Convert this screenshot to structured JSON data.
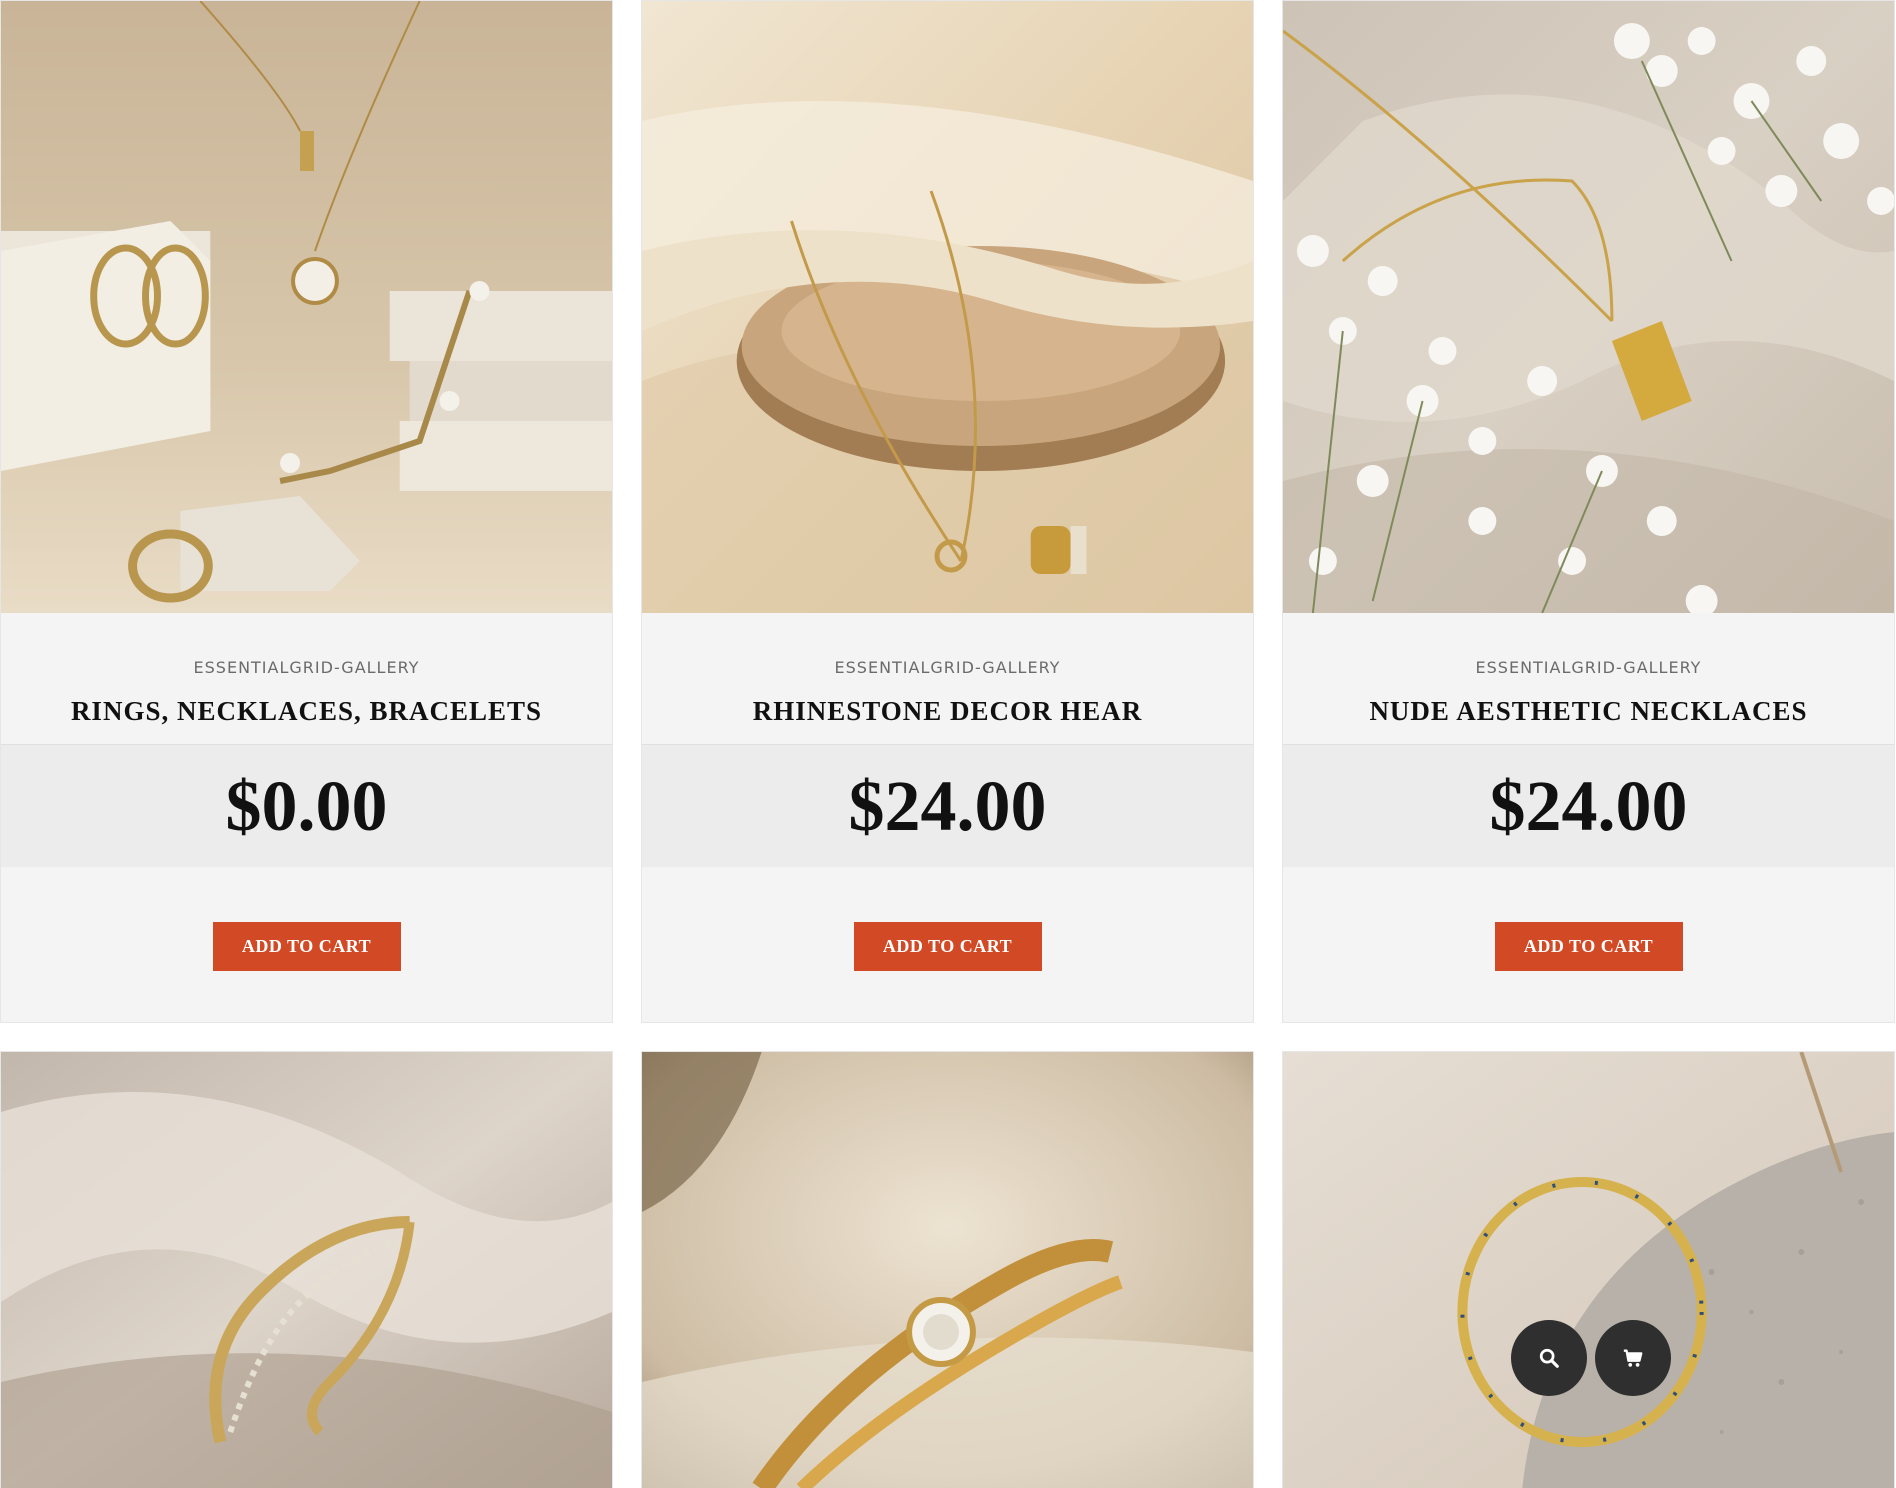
{
  "products": [
    {
      "category": "ESSENTIALGRID-GALLERY",
      "title": "RINGS, NECKLACES, BRACELETS",
      "price": "$0.00",
      "cta": "ADD TO CART",
      "image": "jewelry-set-photo"
    },
    {
      "category": "ESSENTIALGRID-GALLERY",
      "title": "RHINESTONE DECOR HEAR",
      "price": "$24.00",
      "cta": "ADD TO CART",
      "image": "gold-bracelet-photo"
    },
    {
      "category": "ESSENTIALGRID-GALLERY",
      "title": "NUDE AESTHETIC NECKLACES",
      "price": "$24.00",
      "cta": "ADD TO CART",
      "image": "pendant-necklace-photo"
    },
    {
      "image": "twisted-ring-photo"
    },
    {
      "image": "diamond-ring-photo"
    },
    {
      "image": "evil-eye-bracelet-photo"
    }
  ],
  "overlay": {
    "search_icon": "search-icon",
    "cart_icon": "cart-icon"
  },
  "colors": {
    "accent": "#d24a25",
    "card_bg": "#f4f4f4",
    "price_band": "#ececec",
    "overlay_btn": "#2f2f2f"
  }
}
